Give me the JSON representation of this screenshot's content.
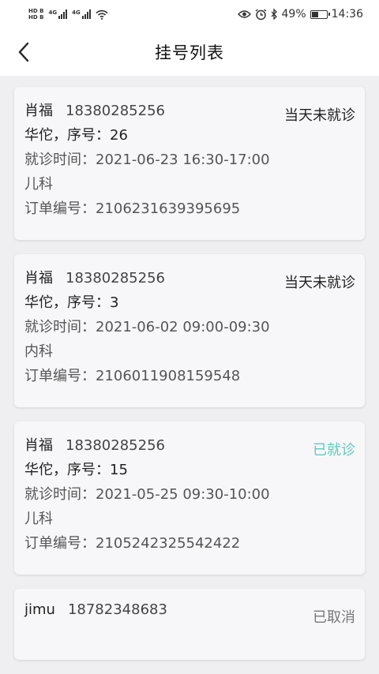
{
  "status_bar": {
    "hd1": "HD",
    "hd1_sub": "B",
    "hd2": "HD",
    "hd2_sub": "B",
    "net1": "4G",
    "net2": "4G",
    "battery_percent": "49%",
    "battery_level": 0.49,
    "time": "14:36",
    "icons": [
      "eye-icon",
      "alarm-icon",
      "bluetooth-icon",
      "battery-icon"
    ]
  },
  "nav": {
    "title": "挂号列表",
    "back_icon": "chevron-left-icon"
  },
  "colors": {
    "pending": "#222222",
    "visited": "#5ec9c0",
    "cancelled": "#777777"
  },
  "appointments": [
    {
      "name": "肖福",
      "phone": "18380285256",
      "status": "当天未就诊",
      "doctor_line": "华佗，序号：26",
      "time_line": "就诊时间：2021-06-23 16:30-17:00",
      "department": "儿科",
      "order_line": "订单编号：2106231639395695"
    },
    {
      "name": "肖福",
      "phone": "18380285256",
      "status": "当天未就诊",
      "doctor_line": "华佗，序号：3",
      "time_line": "就诊时间：2021-06-02 09:00-09:30",
      "department": "内科",
      "order_line": "订单编号：2106011908159548"
    },
    {
      "name": "肖福",
      "phone": "18380285256",
      "status": "已就诊",
      "doctor_line": "华佗，序号：15",
      "time_line": "就诊时间：2021-05-25 09:30-10:00",
      "department": "儿科",
      "order_line": "订单编号：2105242325542422"
    },
    {
      "name": "jimu",
      "phone": "18782348683",
      "status": "已取消"
    }
  ]
}
